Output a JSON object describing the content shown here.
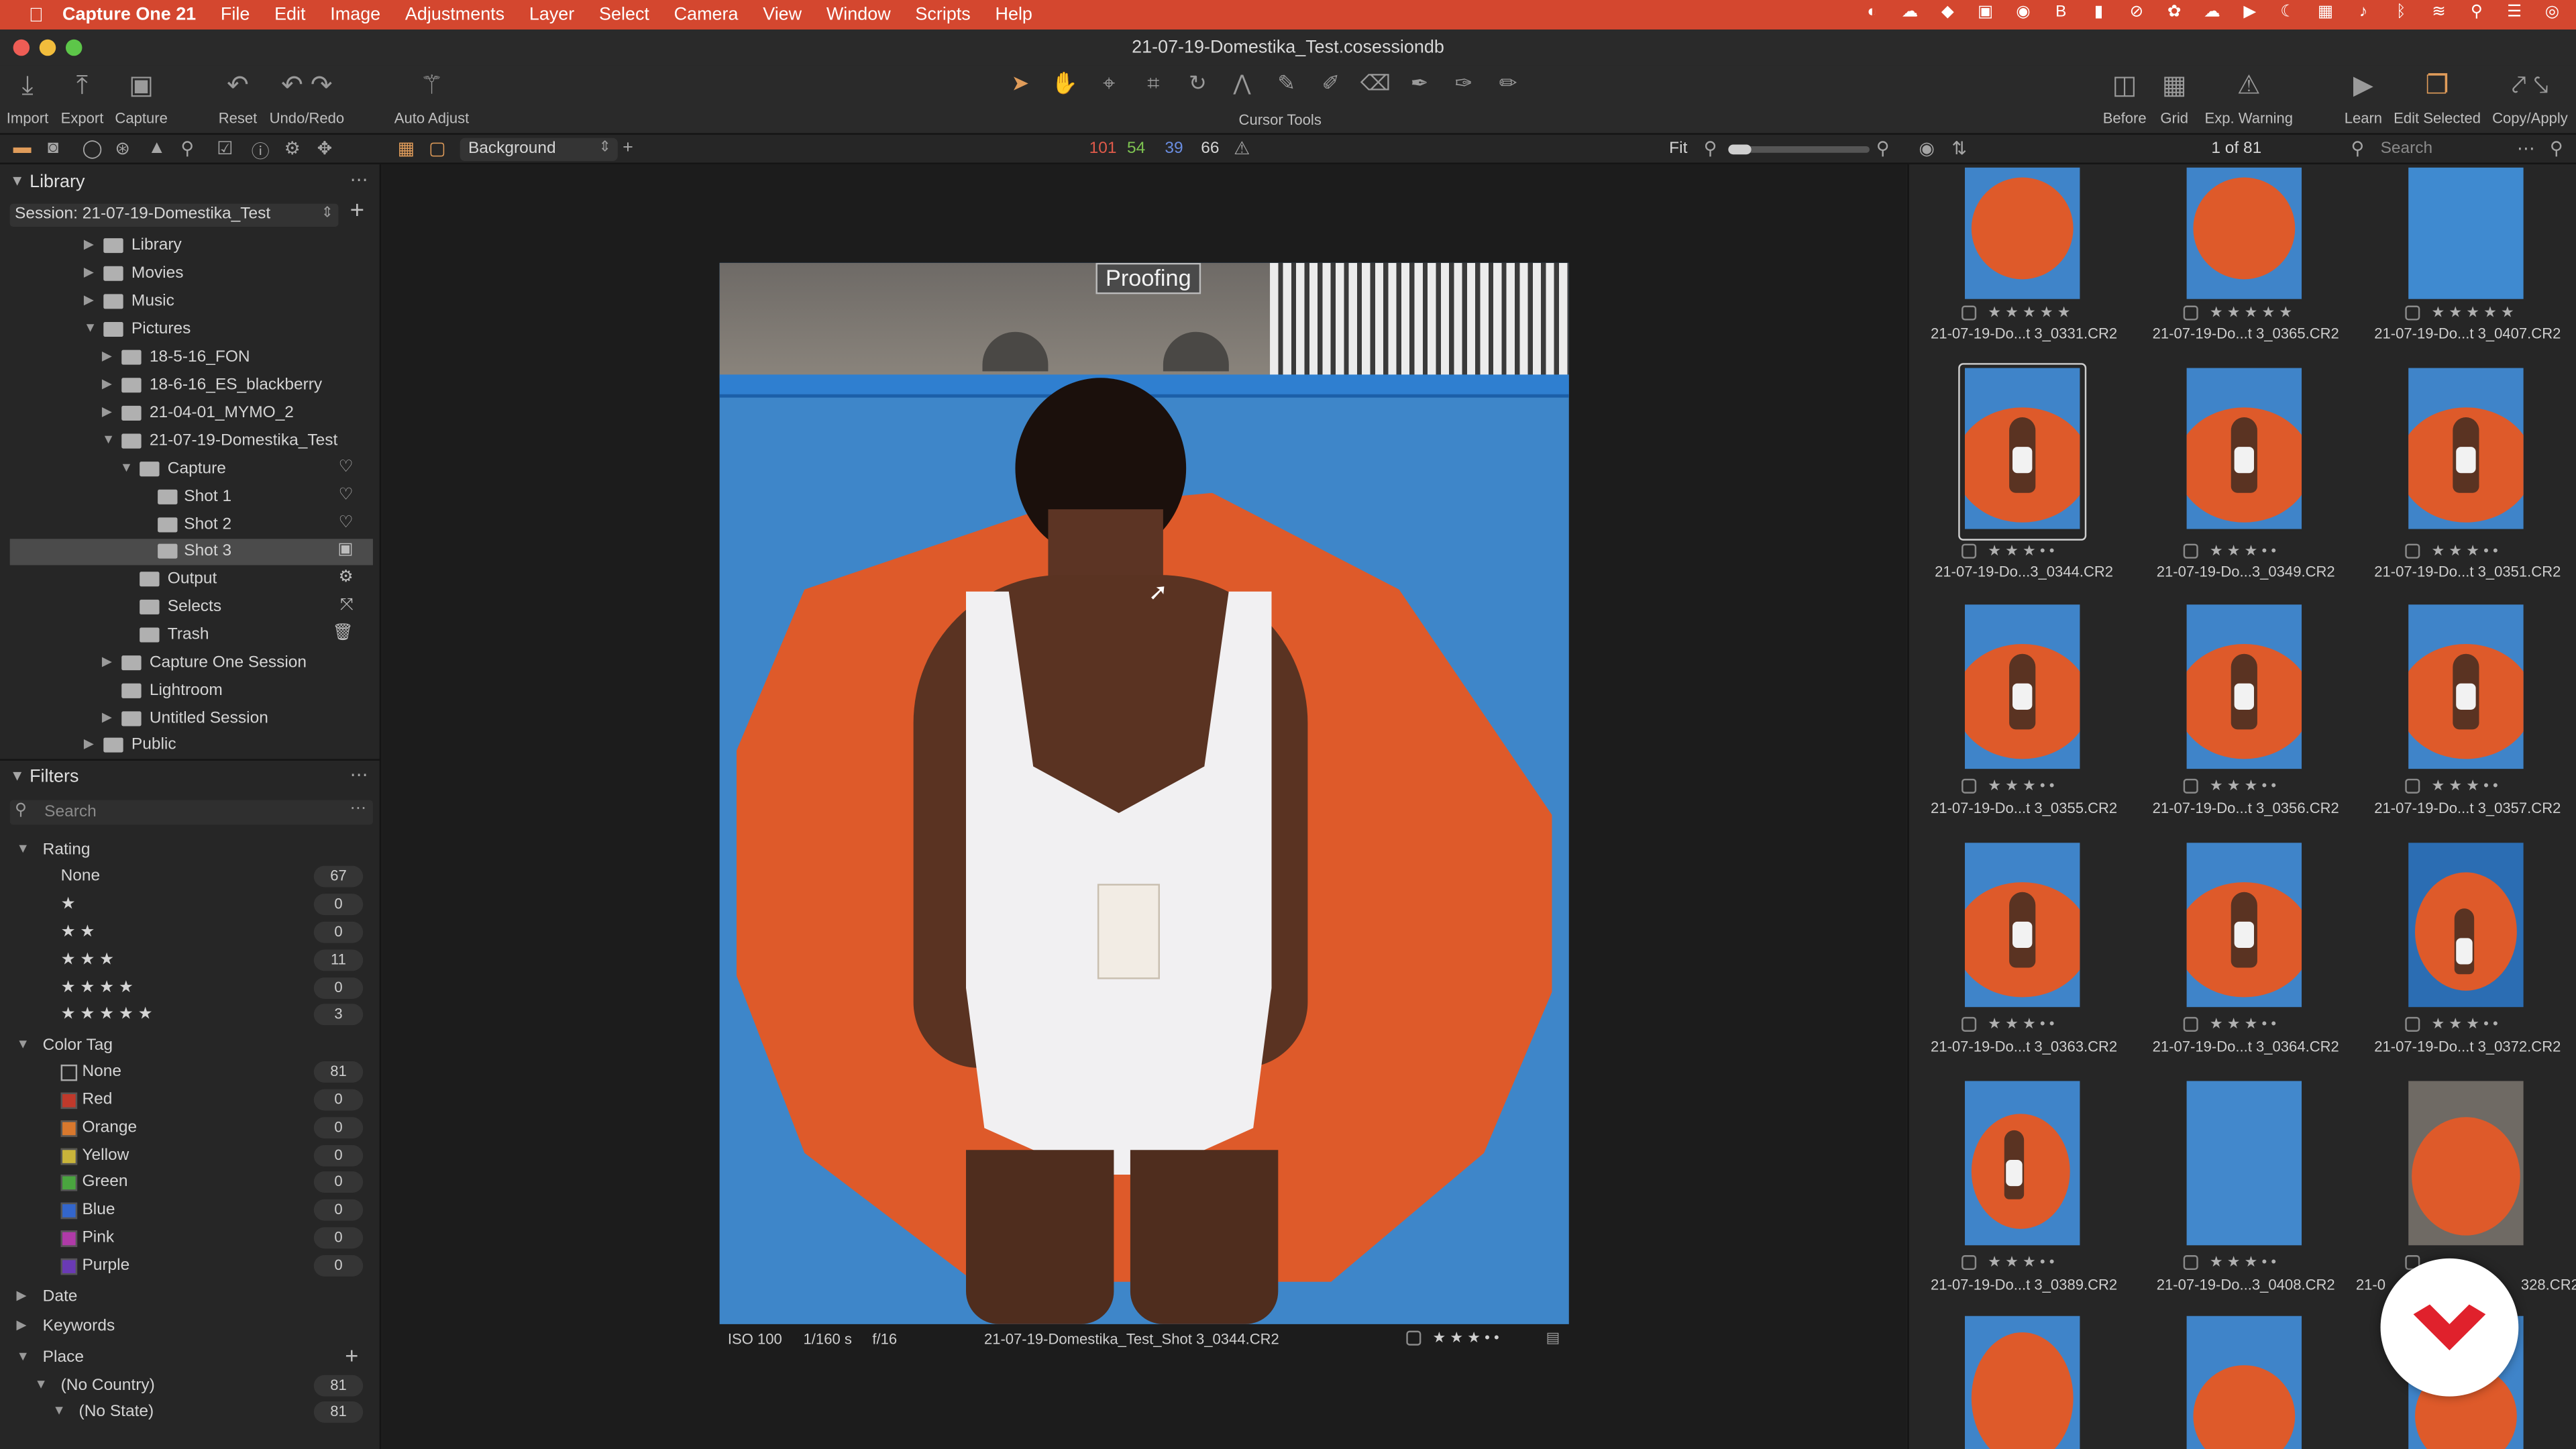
{
  "menubar": {
    "app": "Capture One 21",
    "items": [
      "File",
      "Edit",
      "Image",
      "Adjustments",
      "Layer",
      "Select",
      "Camera",
      "View",
      "Window",
      "Scripts",
      "Help"
    ]
  },
  "window": {
    "title": "21-07-19-Domestika_Test.cosessiondb"
  },
  "toolbar": {
    "import": "Import",
    "export": "Export",
    "capture": "Capture",
    "reset": "Reset",
    "undo_redo": "Undo/Redo",
    "auto_adjust": "Auto Adjust",
    "cursor_tools": "Cursor Tools",
    "before": "Before",
    "grid": "Grid",
    "exp_warning": "Exp. Warning",
    "learn": "Learn",
    "edit_selected": "Edit Selected",
    "copy_apply": "Copy/Apply"
  },
  "subbar": {
    "layer": "Background",
    "levels": {
      "r": "101",
      "g": "54",
      "b": "39",
      "l": "66"
    },
    "fit": "Fit",
    "counter": "1 of 81",
    "search_placeholder": "Search"
  },
  "library": {
    "title": "Library",
    "session": "Session: 21-07-19-Domestika_Test",
    "tree": [
      {
        "label": "Library"
      },
      {
        "label": "Movies"
      },
      {
        "label": "Music"
      },
      {
        "label": "Pictures"
      },
      {
        "label": "18-5-16_FON"
      },
      {
        "label": "18-6-16_ES_blackberry"
      },
      {
        "label": "21-04-01_MYMO_2"
      },
      {
        "label": "21-07-19-Domestika_Test"
      },
      {
        "label": "Capture"
      },
      {
        "label": "Shot 1"
      },
      {
        "label": "Shot 2"
      },
      {
        "label": "Shot 3"
      },
      {
        "label": "Output"
      },
      {
        "label": "Selects"
      },
      {
        "label": "Trash"
      },
      {
        "label": "Capture One Session"
      },
      {
        "label": "Lightroom"
      },
      {
        "label": "Untitled Session"
      },
      {
        "label": "Public"
      }
    ]
  },
  "filters": {
    "title": "Filters",
    "search_placeholder": "Search",
    "rating_title": "Rating",
    "rating": [
      {
        "label": "None",
        "count": "67"
      },
      {
        "label": "★",
        "count": "0"
      },
      {
        "label": "★ ★",
        "count": "0"
      },
      {
        "label": "★ ★ ★",
        "count": "11"
      },
      {
        "label": "★ ★ ★ ★",
        "count": "0"
      },
      {
        "label": "★ ★ ★ ★ ★",
        "count": "3"
      }
    ],
    "color_tag_title": "Color Tag",
    "color_tags": [
      {
        "label": "None",
        "count": "81",
        "color": "#262626"
      },
      {
        "label": "Red",
        "count": "0",
        "color": "#c0392b"
      },
      {
        "label": "Orange",
        "count": "0",
        "color": "#d9782d"
      },
      {
        "label": "Yellow",
        "count": "0",
        "color": "#c9b43a"
      },
      {
        "label": "Green",
        "count": "0",
        "color": "#4aa53f"
      },
      {
        "label": "Blue",
        "count": "0",
        "color": "#3366cc"
      },
      {
        "label": "Pink",
        "count": "0",
        "color": "#b03aa8"
      },
      {
        "label": "Purple",
        "count": "0",
        "color": "#6a3ab5"
      }
    ],
    "date": "Date",
    "keywords": "Keywords",
    "place": "Place",
    "no_country": "(No Country)",
    "no_country_count": "81",
    "no_state": "(No State)",
    "no_state_count": "81"
  },
  "viewer": {
    "proofing": "Proofing",
    "iso": "ISO 100",
    "shutter": "1/160 s",
    "aperture": "f/16",
    "filename": "21-07-19-Domestika_Test_Shot 3_0344.CR2",
    "rating": "★ ★ ★ • •"
  },
  "thumbnails": [
    {
      "name": "21-07-19-Do...t 3_0331.CR2",
      "stars": "★ ★ ★ ★ ★"
    },
    {
      "name": "21-07-19-Do...t 3_0365.CR2",
      "stars": "★ ★ ★ ★ ★"
    },
    {
      "name": "21-07-19-Do...t 3_0407.CR2",
      "stars": "★ ★ ★ ★ ★"
    },
    {
      "name": "21-07-19-Do...3_0344.CR2",
      "stars": "★ ★ ★ • •"
    },
    {
      "name": "21-07-19-Do...3_0349.CR2",
      "stars": "★ ★ ★ • •"
    },
    {
      "name": "21-07-19-Do...t 3_0351.CR2",
      "stars": "★ ★ ★ • •"
    },
    {
      "name": "21-07-19-Do...t 3_0355.CR2",
      "stars": "★ ★ ★ • •"
    },
    {
      "name": "21-07-19-Do...t 3_0356.CR2",
      "stars": "★ ★ ★ • •"
    },
    {
      "name": "21-07-19-Do...t 3_0357.CR2",
      "stars": "★ ★ ★ • •"
    },
    {
      "name": "21-07-19-Do...t 3_0363.CR2",
      "stars": "★ ★ ★ • •"
    },
    {
      "name": "21-07-19-Do...t 3_0364.CR2",
      "stars": "★ ★ ★ • •"
    },
    {
      "name": "21-07-19-Do...t 3_0372.CR2",
      "stars": "★ ★ ★ • •"
    },
    {
      "name": "21-07-19-Do...t 3_0389.CR2",
      "stars": "★ ★ ★ • •"
    },
    {
      "name": "21-07-19-Do...3_0408.CR2",
      "stars": "★ ★ ★ • •"
    },
    {
      "name": "21-0",
      "stars": "★ ★ ★ • •"
    },
    {
      "name": "328.CR2",
      "stars": ""
    }
  ],
  "colors": {
    "menubar": "#d4472f",
    "accent": "#e09c5a",
    "sky": "#3f84c9",
    "umbrella": "#de5a2a"
  }
}
